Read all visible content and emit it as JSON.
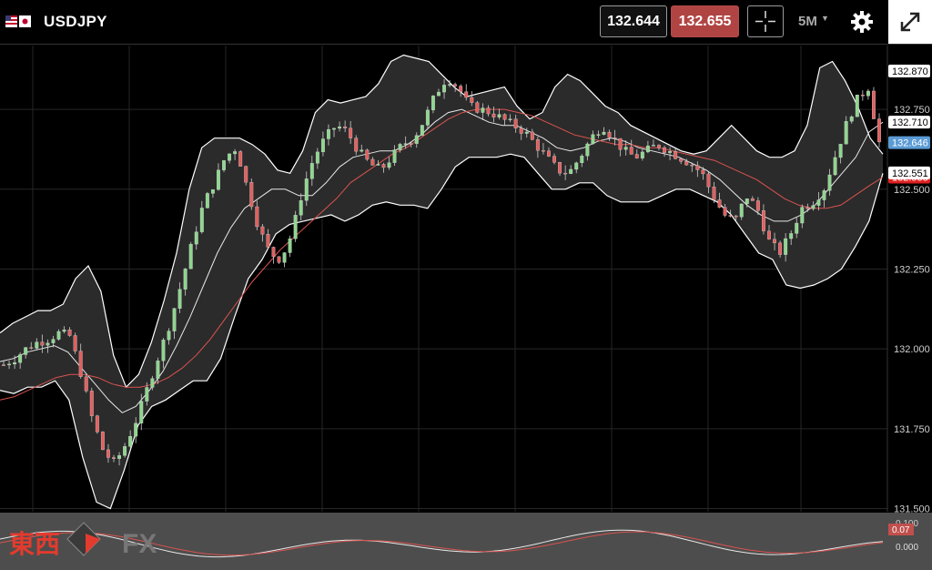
{
  "header": {
    "symbol": "USDJPY",
    "bid": "132.644",
    "ask": "132.655",
    "timeframe": "5M"
  },
  "watermark": {
    "text_jp": "東西",
    "text_fx": "FX"
  },
  "colors": {
    "background": "#000000",
    "band_fill": "#2b2b2b",
    "band_line": "#ffffff",
    "ma_red": "#d9534f",
    "candle_up": "#8fd68f",
    "candle_down": "#e06060",
    "ask_bg": "#b04442",
    "bid_label_bg": "#5b9bd5"
  },
  "chart_data": {
    "type": "candlestick",
    "y_axis": {
      "ticks": [
        "132.750",
        "132.500",
        "132.250",
        "132.000",
        "131.750",
        "131.500"
      ],
      "ylim": [
        131.49,
        132.95
      ]
    },
    "price_labels": {
      "upper_band": "132.870",
      "middle_band": "132.710",
      "last_price": "132.646",
      "lower_band": "132.551",
      "ma_red": "132.538"
    },
    "series": {
      "close": [
        131.95,
        131.97,
        132.0,
        132.02,
        132.03,
        132.05,
        132.04,
        131.92,
        131.78,
        131.68,
        131.64,
        131.7,
        131.78,
        131.88,
        131.98,
        132.08,
        132.2,
        132.33,
        132.45,
        132.52,
        132.6,
        132.63,
        132.5,
        132.38,
        132.3,
        132.28,
        132.36,
        132.5,
        132.6,
        132.66,
        132.7,
        132.68,
        132.62,
        132.58,
        132.56,
        132.6,
        132.64,
        132.66,
        132.72,
        132.8,
        132.85,
        132.82,
        132.76,
        132.75,
        132.74,
        132.72,
        132.7,
        132.68,
        132.64,
        132.6,
        132.56,
        132.55,
        132.6,
        132.66,
        132.7,
        132.66,
        132.62,
        132.6,
        132.62,
        132.64,
        132.62,
        132.6,
        132.58,
        132.55,
        132.48,
        132.42,
        132.4,
        132.48,
        132.44,
        132.34,
        132.3,
        132.36,
        132.44,
        132.46,
        132.5,
        132.6,
        132.7,
        132.78,
        132.82,
        132.646
      ],
      "upper_band": [
        132.05,
        132.08,
        132.1,
        132.12,
        132.12,
        132.14,
        132.22,
        132.26,
        132.18,
        131.98,
        131.88,
        131.92,
        132.02,
        132.15,
        132.3,
        132.5,
        132.63,
        132.66,
        132.66,
        132.66,
        132.64,
        132.61,
        132.56,
        132.55,
        132.62,
        132.74,
        132.78,
        132.77,
        132.78,
        132.79,
        132.83,
        132.9,
        132.92,
        132.91,
        132.9,
        132.86,
        132.82,
        132.79,
        132.8,
        132.81,
        132.82,
        132.76,
        132.72,
        132.74,
        132.82,
        132.86,
        132.84,
        132.8,
        132.76,
        132.74,
        132.7,
        132.68,
        132.66,
        132.64,
        132.62,
        132.61,
        132.62,
        132.66,
        132.7,
        132.66,
        132.62,
        132.6,
        132.6,
        132.62,
        132.7,
        132.88,
        132.9,
        132.84,
        132.76,
        132.66,
        132.61
      ],
      "middle_band": [
        131.96,
        131.97,
        131.99,
        132.0,
        132.01,
        131.99,
        131.94,
        131.89,
        131.84,
        131.8,
        131.82,
        131.87,
        131.93,
        132.01,
        132.1,
        132.2,
        132.3,
        132.38,
        132.44,
        132.47,
        132.5,
        132.5,
        132.48,
        132.48,
        132.52,
        132.57,
        132.6,
        132.61,
        132.62,
        132.62,
        132.64,
        132.67,
        132.71,
        132.74,
        132.75,
        132.73,
        132.71,
        132.7,
        132.7,
        132.68,
        132.66,
        132.63,
        132.62,
        132.63,
        132.65,
        132.66,
        132.65,
        132.63,
        132.62,
        132.61,
        132.6,
        132.58,
        132.56,
        132.53,
        132.49,
        132.45,
        132.42,
        132.4,
        132.4,
        132.42,
        132.45,
        132.5,
        132.55,
        132.6,
        132.68,
        132.71
      ],
      "lower_band": [
        131.87,
        131.86,
        131.88,
        131.88,
        131.9,
        131.84,
        131.66,
        131.52,
        131.5,
        131.62,
        131.76,
        131.82,
        131.84,
        131.87,
        131.9,
        131.9,
        131.97,
        132.1,
        132.22,
        132.28,
        132.36,
        132.39,
        132.4,
        132.41,
        132.42,
        132.4,
        132.42,
        132.45,
        132.46,
        132.45,
        132.45,
        132.44,
        132.5,
        132.57,
        132.6,
        132.6,
        132.6,
        132.61,
        132.6,
        132.55,
        132.5,
        132.5,
        132.52,
        132.52,
        132.48,
        132.46,
        132.46,
        132.46,
        132.48,
        132.5,
        132.5,
        132.48,
        132.46,
        132.42,
        132.36,
        132.3,
        132.28,
        132.2,
        132.19,
        132.2,
        132.22,
        132.25,
        132.32,
        132.4,
        132.55
      ],
      "ma_red": [
        131.84,
        131.85,
        131.87,
        131.89,
        131.91,
        131.92,
        131.92,
        131.91,
        131.89,
        131.88,
        131.88,
        131.89,
        131.91,
        131.94,
        131.98,
        132.03,
        132.09,
        132.15,
        132.21,
        132.26,
        132.31,
        132.35,
        132.39,
        132.43,
        132.47,
        132.52,
        132.55,
        132.58,
        132.61,
        132.63,
        132.66,
        132.69,
        132.72,
        132.74,
        132.75,
        132.75,
        132.75,
        132.74,
        132.73,
        132.71,
        132.69,
        132.67,
        132.66,
        132.65,
        132.64,
        132.64,
        132.63,
        132.63,
        132.62,
        132.61,
        132.6,
        132.59,
        132.57,
        132.55,
        132.53,
        132.5,
        132.47,
        132.45,
        132.44,
        132.44,
        132.45,
        132.48,
        132.51,
        132.538
      ]
    }
  }
}
